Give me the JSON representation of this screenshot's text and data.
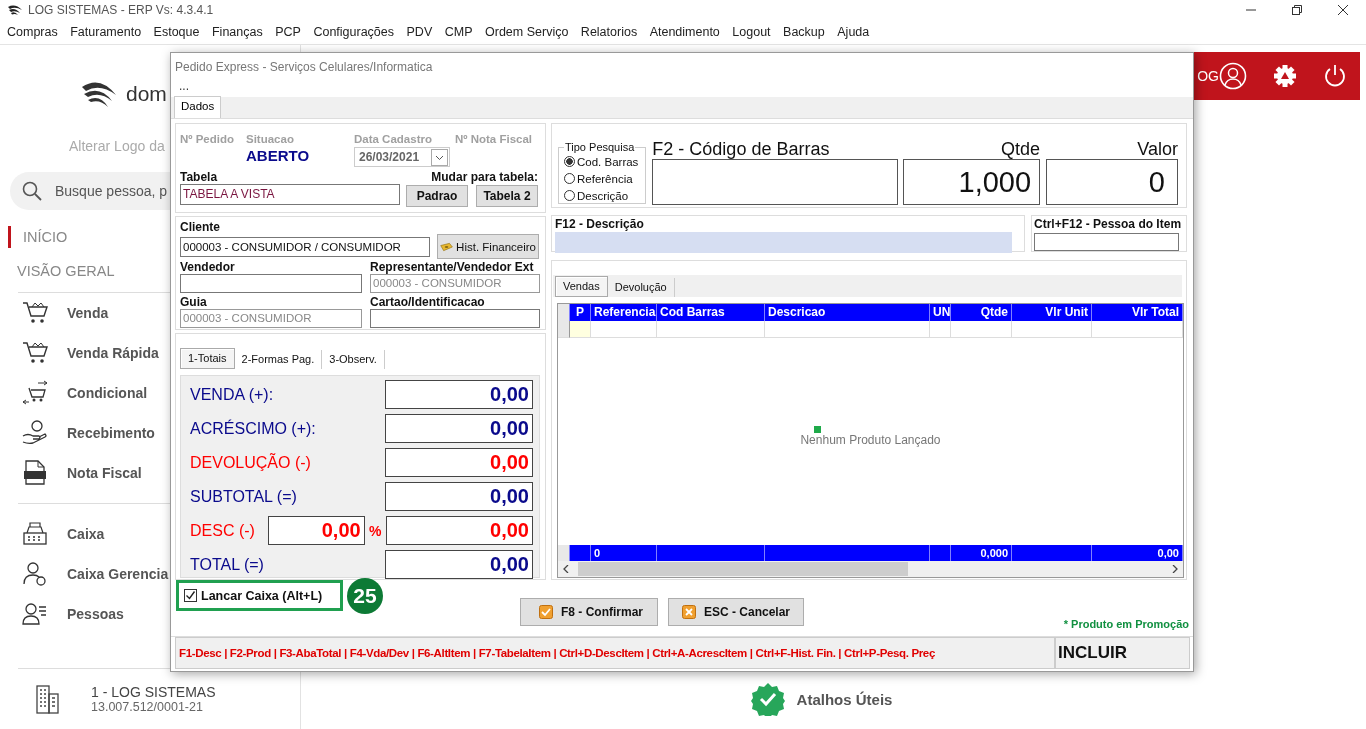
{
  "app": {
    "title": "LOG SISTEMAS - ERP Vs: 4.3.4.1",
    "menu": [
      "Compras",
      "Faturamento",
      "Estoque",
      "Finanças",
      "PCP",
      "Configurações",
      "PDV",
      "CMP",
      "Ordem Serviço",
      "Relatorios",
      "Atendimento",
      "Logout",
      "Backup",
      "Ajuda"
    ]
  },
  "sidebar": {
    "logo_text": "dom",
    "logo_hint": "Alterar Logo da",
    "search": {
      "placeholder": "Busque pessoa, p"
    },
    "sections": [
      {
        "label": "INÍCIO",
        "selected": true
      },
      {
        "label": "VISÃO GERAL",
        "selected": false
      }
    ],
    "groups": [
      [
        "Venda",
        "Venda Rápida",
        "Condicional",
        "Recebimento",
        "Nota Fiscal"
      ],
      [
        "Caixa",
        "Caixa Gerencia",
        "Pessoas"
      ]
    ],
    "company": {
      "name": "1 - LOG SISTEMAS",
      "document": "13.007.512/0001-21"
    }
  },
  "header": {
    "user_label": "OG"
  },
  "shortcuts": {
    "label": "Atalhos Úteis"
  },
  "dialog": {
    "title": "Pedido Express - Serviços Celulares/Informatica",
    "menu": "...",
    "tabs": [
      {
        "label": "Dados",
        "selected": true
      }
    ],
    "order": {
      "labels": [
        "Nº Pedido",
        "Situacao",
        "Data Cadastro",
        "Nº Nota Fiscal"
      ],
      "status": "ABERTO",
      "date": "26/03/2021",
      "table_label": "Tabela",
      "table_value": "TABELA A VISTA",
      "change_label": "Mudar para tabela:",
      "change_buttons": [
        "Padrao",
        "Tabela 2"
      ]
    },
    "customer": {
      "label": "Cliente",
      "value": "000003 - CONSUMIDOR / CONSUMIDOR",
      "history_button": "Hist. Financeiro",
      "fields": [
        {
          "label": "Vendedor",
          "disabled": false
        },
        {
          "label": "Representante/Vendedor Ext",
          "value": "000003 - CONSUMIDOR",
          "disabled": true
        },
        {
          "label": "Guia",
          "value": "000003 - CONSUMIDOR",
          "disabled": true
        },
        {
          "label": "Cartao/Identificacao",
          "disabled": false
        }
      ]
    },
    "totals_tabs": [
      {
        "label": "1-Totais",
        "selected": true
      },
      {
        "label": "2-Formas Pag.",
        "selected": false
      },
      {
        "label": "3-Observ.",
        "selected": false
      }
    ],
    "totals": [
      {
        "label": "VENDA (+):",
        "value": "0,00",
        "color": "#0a0a8c"
      },
      {
        "label": "ACRÉSCIMO (+):",
        "value": "0,00",
        "color": "#0a0a8c"
      },
      {
        "label": "DEVOLUÇÃO (-)",
        "value": "0,00",
        "color": "#ff0000"
      },
      {
        "label": "SUBTOTAL (=)",
        "value": "0,00",
        "color": "#0a0a8c"
      },
      {
        "label": "DESC (-)",
        "value": "0,00",
        "color": "#ff0000",
        "percent": "0,00",
        "percent_sign": "%"
      },
      {
        "label": "TOTAL  (=)",
        "value": "0,00",
        "color": "#0a0a8c"
      }
    ],
    "search_type": {
      "title": "Tipo Pesquisa",
      "options": [
        {
          "label": "Cod. Barras",
          "selected": true
        },
        {
          "label": "Referência",
          "selected": false
        },
        {
          "label": "Descrição",
          "selected": false
        }
      ]
    },
    "barcode": {
      "label": "F2 - Código de Barras"
    },
    "quantity": {
      "label": "Qtde",
      "value": "1,000"
    },
    "price": {
      "label": "Valor",
      "value": "0"
    },
    "description": {
      "label": "F12 - Descrição"
    },
    "item_person": {
      "label": "Ctrl+F12 - Pessoa do Item"
    },
    "grid_tabs": [
      {
        "label": "Vendas",
        "selected": true
      },
      {
        "label": "Devolução",
        "selected": false
      }
    ],
    "grid": {
      "columns": [
        "P",
        "Referencia",
        "Cod Barras",
        "Descricao",
        "UN",
        "Qtde",
        "Vlr Unit",
        "Vlr Total"
      ],
      "empty_text": "Nenhum Produto Lançado",
      "footer": {
        "referencia": "0",
        "qtde": "0,000",
        "vlr_total": "0,00"
      }
    },
    "launch_cash": {
      "label": "Lancar Caixa (Alt+L)",
      "checked": true
    },
    "annotation": "25",
    "buttons": [
      {
        "label": "F8 - Confirmar",
        "kind": "confirm"
      },
      {
        "label": "ESC - Cancelar",
        "kind": "cancel"
      }
    ],
    "promo_note": "* Produto em Promoção",
    "hotkeys": "F1-Desc | F2-Prod | F3-AbaTotal | F4-Vda/Dev | F6-AltItem | F7-TabelaItem | Ctrl+D-DescItem | Ctrl+A-AcrescItem | Ctrl+F-Hist. Fin. | Ctrl+P-Pesq. Preç",
    "mode": "INCLUIR"
  }
}
